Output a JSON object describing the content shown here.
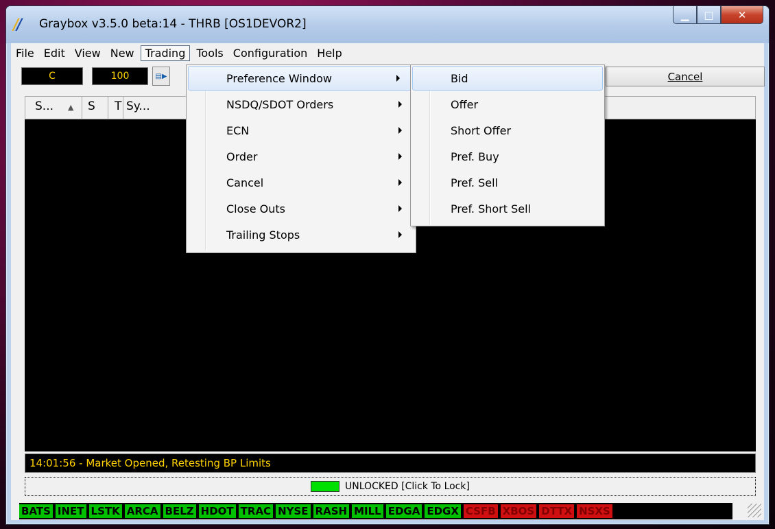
{
  "window": {
    "title": "Graybox v3.5.0 beta:14 - THRB [OS1DEVOR2]"
  },
  "menubar": [
    "File",
    "Edit",
    "View",
    "New",
    "Trading",
    "Tools",
    "Configuration",
    "Help"
  ],
  "toolbar": {
    "side": "C",
    "qty": "100",
    "cancel_label": "Cancel"
  },
  "columns": [
    "S...",
    "S",
    "T",
    "Sy..."
  ],
  "trading_menu": [
    "Preference Window",
    "NSDQ/SDOT Orders",
    "ECN",
    "Order",
    "Cancel",
    "Close Outs",
    "Trailing Stops"
  ],
  "preference_submenu": [
    "Bid",
    "Offer",
    "Short Offer",
    "Pref. Buy",
    "Pref. Sell",
    "Pref. Short Sell"
  ],
  "status": {
    "message": "14:01:56 - Market Opened, Retesting BP Limits",
    "lock": "UNLOCKED [Click To Lock]"
  },
  "exchanges": [
    {
      "name": "BATS",
      "state": "on"
    },
    {
      "name": "INET",
      "state": "on"
    },
    {
      "name": "LSTK",
      "state": "on"
    },
    {
      "name": "ARCA",
      "state": "on"
    },
    {
      "name": "BELZ",
      "state": "on"
    },
    {
      "name": "HDOT",
      "state": "on"
    },
    {
      "name": "TRAC",
      "state": "on"
    },
    {
      "name": "NYSE",
      "state": "on"
    },
    {
      "name": "RASH",
      "state": "on"
    },
    {
      "name": "MILL",
      "state": "on"
    },
    {
      "name": "EDGA",
      "state": "on"
    },
    {
      "name": "EDGX",
      "state": "on"
    },
    {
      "name": "CSFB",
      "state": "off"
    },
    {
      "name": "XBOS",
      "state": "off"
    },
    {
      "name": "DTTX",
      "state": "off"
    },
    {
      "name": "NSXS",
      "state": "off"
    }
  ]
}
